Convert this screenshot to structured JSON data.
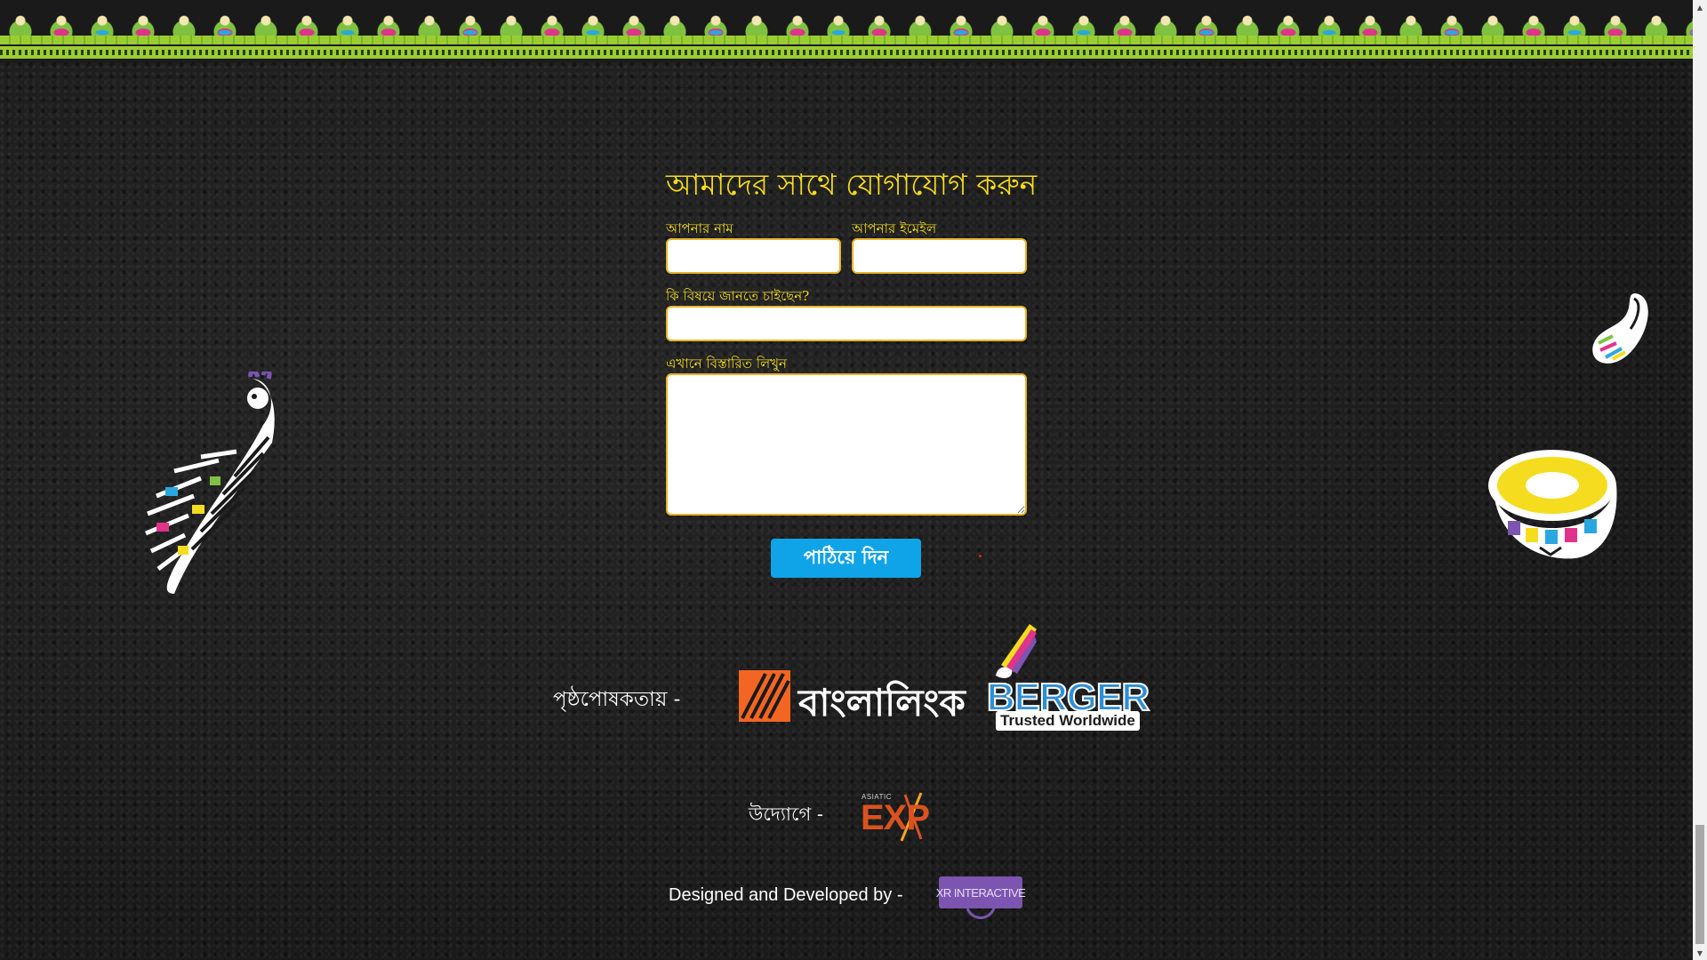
{
  "form": {
    "title": "আমাদের সাথে যোগাযোগ করুন",
    "name_label": "আপনার নাম",
    "name_value": "",
    "email_label": "আপনার ইমেইল",
    "email_value": "",
    "subject_label": "কি বিষয়ে জানতে চাইছেন?",
    "subject_value": "",
    "message_label": "এখানে বিস্তারিত লিখুন",
    "message_value": "",
    "submit_label": "পাঠিয়ে দিন"
  },
  "sponsors": {
    "label": "পৃষ্ঠপোষকতায় -",
    "banglalink_text": "বাংলালিংক",
    "berger_text": "BERGER",
    "berger_tagline": "Trusted Worldwide"
  },
  "organizer": {
    "label": "উদ্যোগে -",
    "exp_small_text": "ASIATIC",
    "exp_text": "EXP"
  },
  "credits": {
    "label": "Designed and Developed by -",
    "developer_text": "XR INTERACTIVE"
  },
  "icons": {
    "top_border": "folk-art-border",
    "peacock": "peacock-icon",
    "drum": "dhol-drum-icon",
    "paisley": "paisley-icon",
    "banglalink": "banglalink-logo",
    "berger": "berger-paint-brush-icon"
  },
  "colors": {
    "title_yellow": "#f5dc1e",
    "field_border": "#e8b429",
    "button_blue": "#0fa4e8",
    "banglalink_orange": "#f26522",
    "berger_blue": "#2e8fd6",
    "exp_orange": "#d9531e",
    "xr_purple": "#7b55b0",
    "border_green": "#9acd32"
  }
}
